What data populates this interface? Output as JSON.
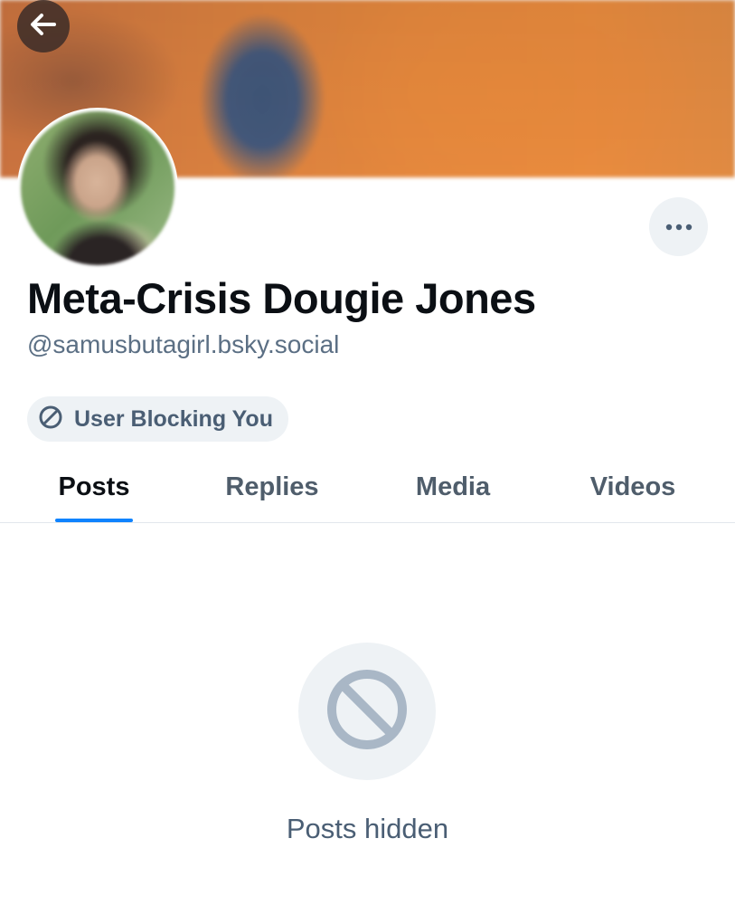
{
  "header": {
    "back_icon": "arrow-left-icon"
  },
  "profile": {
    "display_name": "Meta-Crisis Dougie Jones",
    "handle": "@samusbutagirl.bsky.social",
    "more_icon": "ellipsis-icon",
    "blocking_label": "User Blocking You",
    "blocking_icon": "ban-icon"
  },
  "tabs": [
    {
      "label": "Posts",
      "active": true
    },
    {
      "label": "Replies",
      "active": false
    },
    {
      "label": "Media",
      "active": false
    },
    {
      "label": "Videos",
      "active": false
    }
  ],
  "empty_state": {
    "icon": "ban-icon",
    "message": "Posts hidden"
  },
  "colors": {
    "accent": "#1083fe",
    "muted_text": "#5b6f84",
    "pill_bg": "#eef2f5"
  }
}
